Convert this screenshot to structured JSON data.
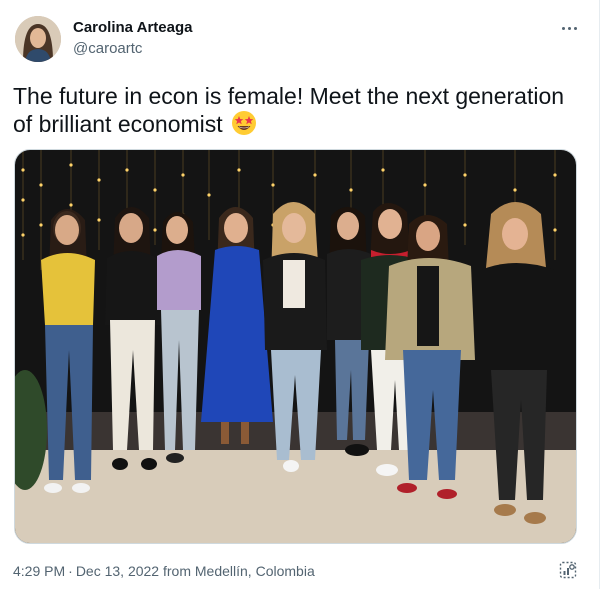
{
  "author": {
    "name": "Carolina Arteaga",
    "handle": "@caroartc"
  },
  "tweet": {
    "text": "The future in econ is female! Meet the next generation of brilliant economist",
    "emoji": "star-struck-emoji"
  },
  "meta": {
    "time": "4:29 PM",
    "separator": "·",
    "date": "Dec 13, 2022",
    "location": "from Medellín, Colombia"
  },
  "icons": {
    "more": "more-horizontal-icon",
    "analytics": "tweet-analytics-icon"
  },
  "colors": {
    "text_primary": "#0f1419",
    "text_secondary": "#536471",
    "border": "#cfd9de"
  }
}
